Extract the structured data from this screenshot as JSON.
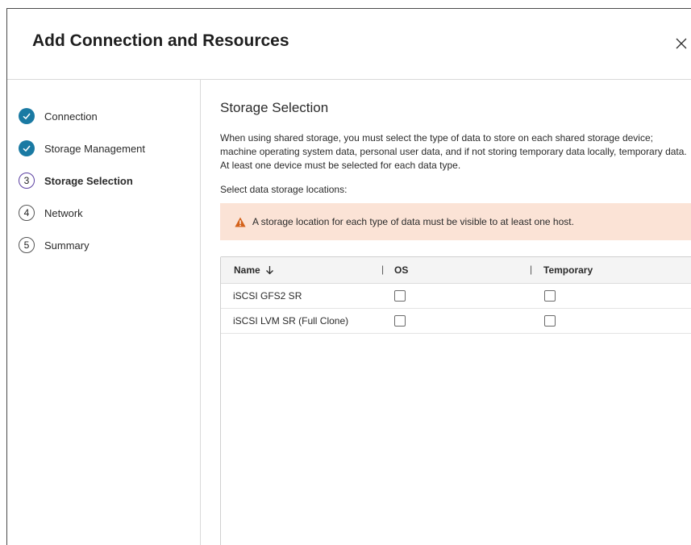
{
  "dialog": {
    "title": "Add Connection and Resources",
    "close_icon": "close-icon"
  },
  "steps": [
    {
      "label": "Connection",
      "state": "done",
      "marker": ""
    },
    {
      "label": "Storage Management",
      "state": "done",
      "marker": ""
    },
    {
      "label": "Storage Selection",
      "state": "current",
      "marker": "3"
    },
    {
      "label": "Network",
      "state": "todo",
      "marker": "4"
    },
    {
      "label": "Summary",
      "state": "todo",
      "marker": "5"
    }
  ],
  "main": {
    "title": "Storage Selection",
    "description": "When using shared storage, you must select the type of data to store on each shared storage device; machine operating system data, personal user data, and if not storing temporary data locally, temporary data. At least one device must be selected for each data type.",
    "select_label": "Select data storage locations:",
    "warning": "A storage location for each type of data must be visible to at least one host.",
    "warning_icon": "warning-icon",
    "warning_color": "#d4621b",
    "warning_bg": "#fbe3d6"
  },
  "table": {
    "headers": {
      "name": "Name",
      "os": "OS",
      "temporary": "Temporary",
      "separator": "|"
    },
    "sort_icon": "arrow-down-icon",
    "rows": [
      {
        "name": "iSCSI GFS2 SR",
        "os": false,
        "temporary": false
      },
      {
        "name": "iSCSI LVM SR (Full Clone)",
        "os": false,
        "temporary": false
      }
    ]
  },
  "colors": {
    "accent_done": "#1a7aa3",
    "accent_current": "#5a3ea0"
  }
}
